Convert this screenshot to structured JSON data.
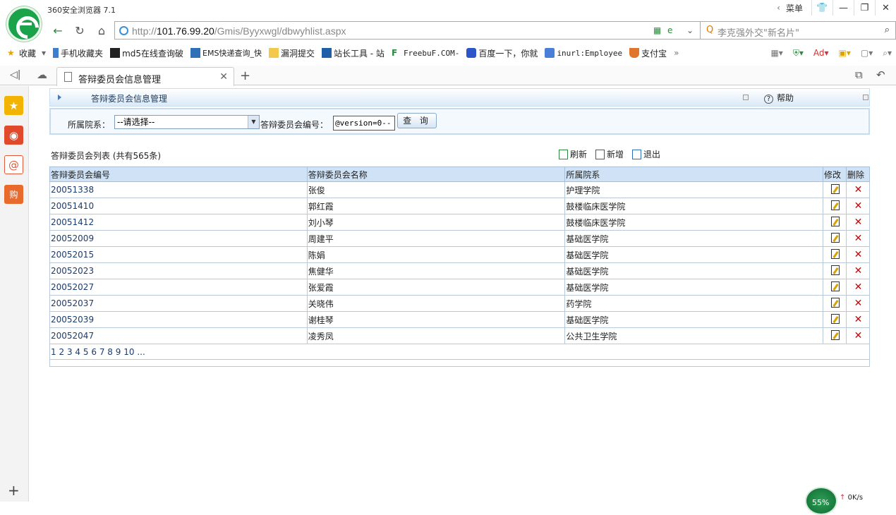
{
  "browser": {
    "app_title": "360安全浏览器 7.1",
    "menu_label": "菜单",
    "url_prefix": "http://",
    "url_host": "101.76.99.20",
    "url_path": "/Gmis/Byyxwgl/dbwyhlist.aspx",
    "search_placeholder": "李克强外交\"新名片\"",
    "bookmarks": [
      "收藏",
      "手机收藏夹",
      "md5在线查询破",
      "EMS快递查询_快",
      "漏洞提交",
      "站长工具 - 站",
      "FreebuF.COM-",
      "百度一下，你就",
      "inurl:Employee",
      "支付宝"
    ],
    "tab_title": "答辩委员会信息管理",
    "speed_percent": "55%",
    "net_rate": "0K/s"
  },
  "page": {
    "header_title": "答辩委员会信息管理",
    "help_label": "帮助",
    "filter": {
      "department_label": "所属院系：",
      "department_selected": "--请选择--",
      "committee_no_label": "答辩委员会编号：",
      "committee_no_value": "@version=0--",
      "query_button": "查 询"
    },
    "list_title": "答辩委员会列表 (共有565条)",
    "actions": {
      "refresh": "刷新",
      "add": "新增",
      "exit": "退出"
    },
    "table": {
      "columns": [
        "答辩委员会编号",
        "答辩委员会名称",
        "所属院系",
        "修改",
        "删除"
      ],
      "rows": [
        {
          "code": "20051338",
          "name": "张俊",
          "dept": "护理学院"
        },
        {
          "code": "20051410",
          "name": "郭红霞",
          "dept": "鼓楼临床医学院"
        },
        {
          "code": "20051412",
          "name": "刘小琴",
          "dept": "鼓楼临床医学院"
        },
        {
          "code": "20052009",
          "name": "周建平",
          "dept": "基础医学院"
        },
        {
          "code": "20052015",
          "name": "陈娟",
          "dept": "基础医学院"
        },
        {
          "code": "20052023",
          "name": "焦健华",
          "dept": "基础医学院"
        },
        {
          "code": "20052027",
          "name": "张爱霞",
          "dept": "基础医学院"
        },
        {
          "code": "20052037",
          "name": "关晓伟",
          "dept": "药学院"
        },
        {
          "code": "20052039",
          "name": "谢桂琴",
          "dept": "基础医学院"
        },
        {
          "code": "20052047",
          "name": "凌秀凤",
          "dept": "公共卫生学院"
        }
      ],
      "pager": [
        "1",
        "2",
        "3",
        "4",
        "5",
        "6",
        "7",
        "8",
        "9",
        "10",
        "..."
      ]
    }
  }
}
